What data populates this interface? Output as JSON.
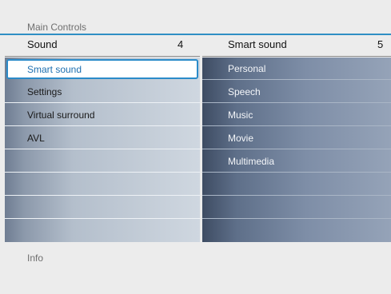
{
  "breadcrumb": "Main Controls",
  "left_header": {
    "title": "Sound",
    "count": "4"
  },
  "right_header": {
    "title": "Smart sound",
    "count": "5"
  },
  "left_items": [
    {
      "label": "Smart sound",
      "selected": true
    },
    {
      "label": "Settings"
    },
    {
      "label": "Virtual surround"
    },
    {
      "label": "AVL"
    },
    {
      "label": ""
    },
    {
      "label": ""
    },
    {
      "label": ""
    },
    {
      "label": ""
    }
  ],
  "right_items": [
    {
      "label": "Personal"
    },
    {
      "label": "Speech"
    },
    {
      "label": "Music"
    },
    {
      "label": "Movie"
    },
    {
      "label": "Multimedia"
    },
    {
      "label": ""
    },
    {
      "label": ""
    },
    {
      "label": ""
    }
  ],
  "footer": {
    "label": "Info"
  },
  "colors": {
    "accent": "#2b8bc9",
    "selected_text": "#1d6fb0"
  }
}
